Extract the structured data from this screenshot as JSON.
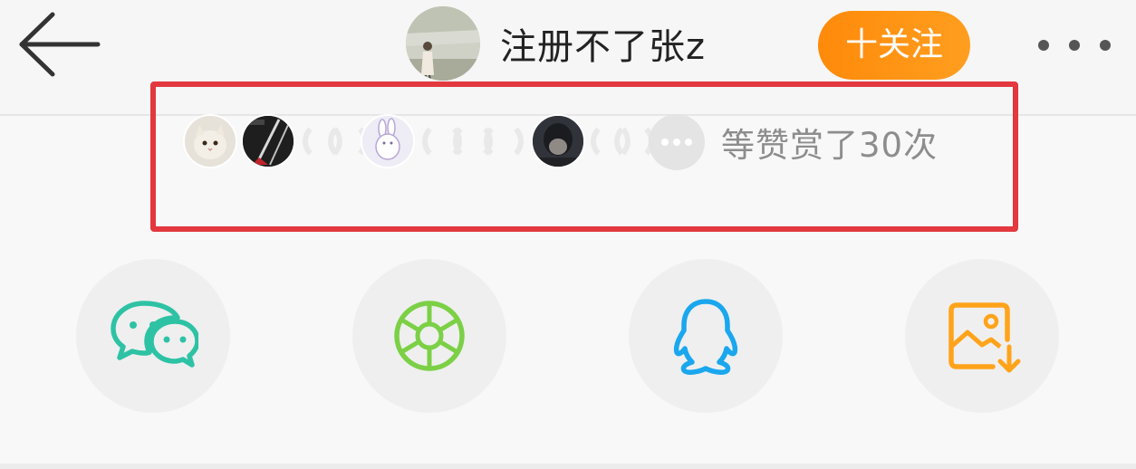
{
  "header": {
    "back_icon": "arrow-left-icon",
    "author_name": "注册不了张z",
    "follow_label": "十关注",
    "more_icon": "more-dots-icon"
  },
  "rewards": {
    "text": "等赞赏了30次",
    "more_icon": "ellipsis-icon"
  },
  "share": {
    "items": [
      {
        "icon": "wechat-icon",
        "color": "#2ec2a5"
      },
      {
        "icon": "moments-shutter-icon",
        "color": "#7bd046"
      },
      {
        "icon": "qq-penguin-icon",
        "color": "#1aa7ee"
      },
      {
        "icon": "save-image-icon",
        "color": "#ffa31a"
      }
    ]
  },
  "colors": {
    "follow": "#ff8f12",
    "highlight_border": "#e2383e",
    "reward_text": "#8d8d8d"
  }
}
